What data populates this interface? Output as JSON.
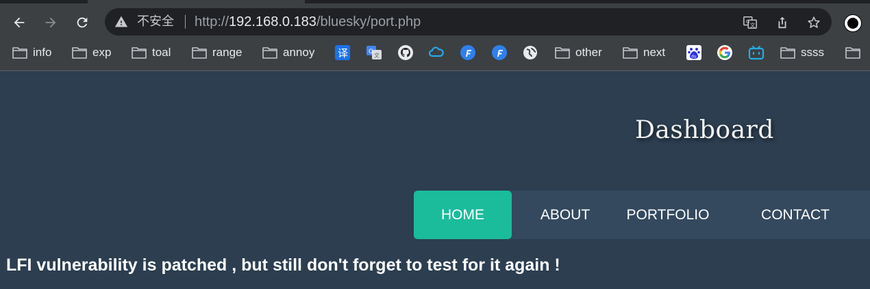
{
  "browser": {
    "address": {
      "security_label": "不安全",
      "url_scheme": "http://",
      "url_host": "192.168.0.183",
      "url_path": "/bluesky/port.php"
    },
    "bookmarks": [
      {
        "label": "info",
        "icon": "folder-icon"
      },
      {
        "label": "exp",
        "icon": "folder-icon"
      },
      {
        "label": "toal",
        "icon": "folder-icon"
      },
      {
        "label": "range",
        "icon": "folder-icon"
      },
      {
        "label": "annoy",
        "icon": "folder-icon"
      },
      {
        "label": "",
        "icon": "translate-icon"
      },
      {
        "label": "",
        "icon": "google-translate-icon"
      },
      {
        "label": "",
        "icon": "github-icon"
      },
      {
        "label": "",
        "icon": "cloud-icon"
      },
      {
        "label": "",
        "icon": "f-app-icon"
      },
      {
        "label": "",
        "icon": "f-app-icon"
      },
      {
        "label": "",
        "icon": "globe-icon"
      },
      {
        "label": "other",
        "icon": "folder-icon"
      },
      {
        "label": "next",
        "icon": "folder-icon"
      },
      {
        "label": "",
        "icon": "baidu-icon"
      },
      {
        "label": "",
        "icon": "google-icon"
      },
      {
        "label": "",
        "icon": "bilibili-icon"
      },
      {
        "label": "ssss",
        "icon": "folder-icon"
      },
      {
        "label": "",
        "icon": "folder-icon"
      }
    ]
  },
  "page": {
    "brand": "Dashboard",
    "nav": [
      {
        "label": "HOME",
        "active": true
      },
      {
        "label": "ABOUT",
        "active": false
      },
      {
        "label": "PORTFOLIO",
        "active": false
      },
      {
        "label": "CONTACT",
        "active": false
      }
    ],
    "message": "LFI vulnerability is patched , but still don't forget to test for it again !"
  },
  "colors": {
    "page_bg": "#2c3e50",
    "nav_bg": "#34495e",
    "nav_active": "#1abc9c",
    "chrome_bg": "#3c4043",
    "omnibox_bg": "#202124"
  }
}
